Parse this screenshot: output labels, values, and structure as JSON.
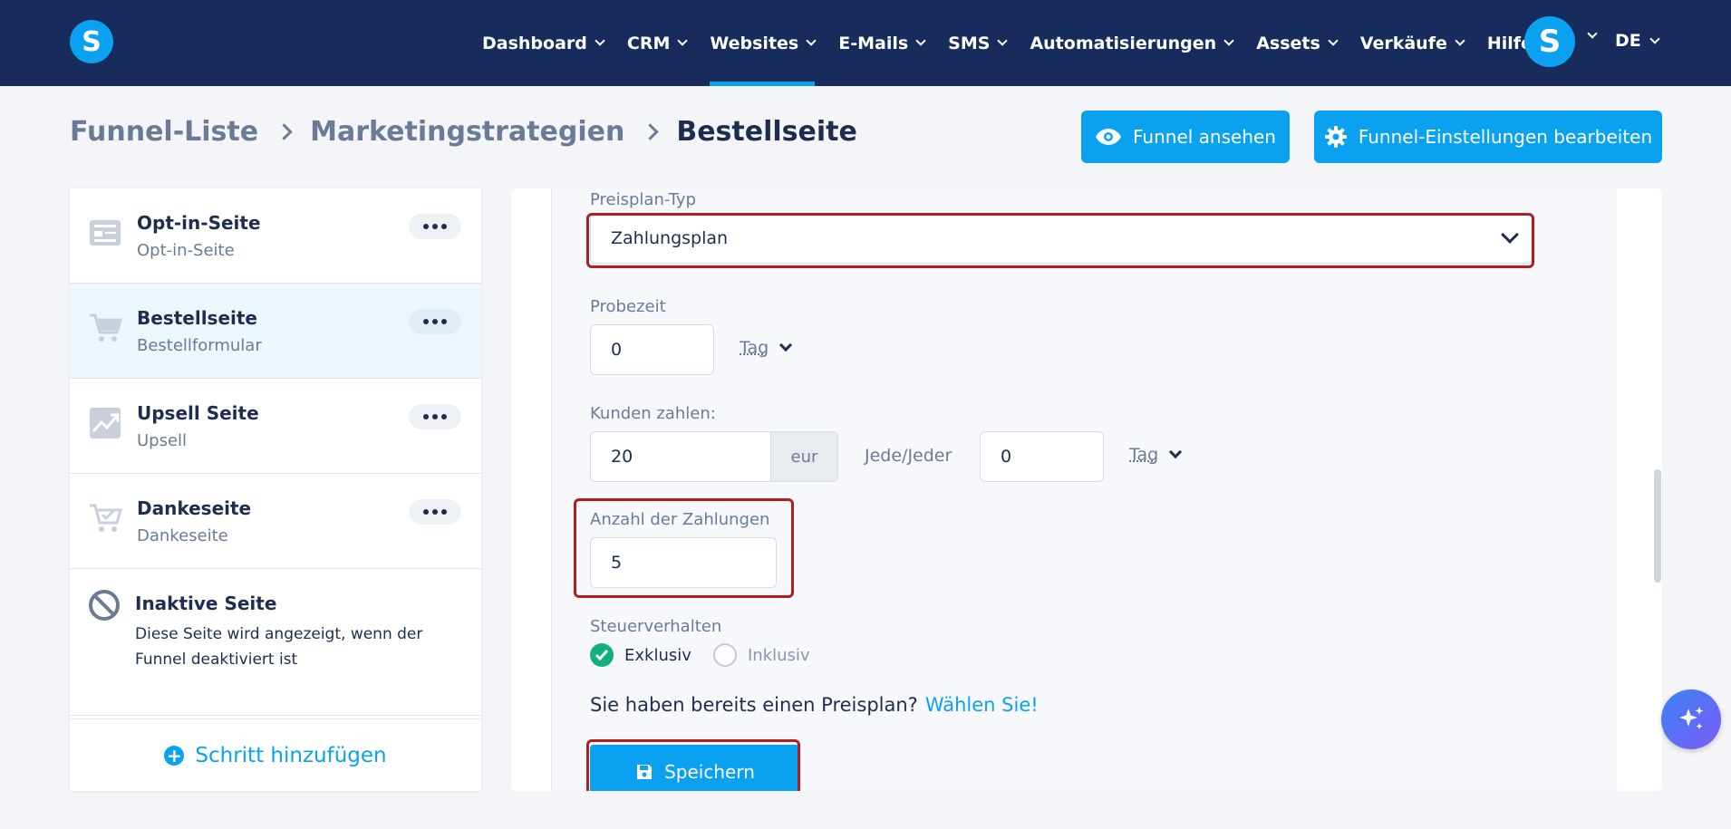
{
  "nav": {
    "logo": "S",
    "items": [
      {
        "label": "Dashboard",
        "dropdown": true
      },
      {
        "label": "CRM",
        "dropdown": true
      },
      {
        "label": "Websites",
        "dropdown": true,
        "active": true
      },
      {
        "label": "E-Mails",
        "dropdown": true
      },
      {
        "label": "SMS",
        "dropdown": true
      },
      {
        "label": "Automatisierungen",
        "dropdown": true
      },
      {
        "label": "Assets",
        "dropdown": true
      },
      {
        "label": "Verkäufe",
        "dropdown": true
      },
      {
        "label": "Hilfe",
        "dropdown": false
      }
    ],
    "avatar_letter": "S",
    "language": "DE"
  },
  "breadcrumb": {
    "items": [
      "Funnel-Liste",
      "Marketingstrategien"
    ],
    "current": "Bestellseite"
  },
  "header_buttons": {
    "view": "Funnel ansehen",
    "settings": "Funnel-Einstellungen bearbeiten"
  },
  "sidebar": {
    "steps": [
      {
        "title": "Opt-in-Seite",
        "subtitle": "Opt-in-Seite",
        "icon": "optin-page-icon"
      },
      {
        "title": "Bestellseite",
        "subtitle": "Bestellformular",
        "icon": "cart-icon",
        "active": true
      },
      {
        "title": "Upsell Seite",
        "subtitle": "Upsell",
        "icon": "trend-chart-icon"
      },
      {
        "title": "Dankeseite",
        "subtitle": "Dankeseite",
        "icon": "cart-check-icon"
      }
    ],
    "inactive": {
      "title": "Inaktive Seite",
      "description": "Diese Seite wird angezeigt, wenn der Funnel deaktiviert ist"
    },
    "add_step": "Schritt hinzufügen"
  },
  "form": {
    "plan_type_label": "Preisplan-Typ",
    "plan_type_value": "Zahlungsplan",
    "trial_label": "Probezeit",
    "trial_value": "0",
    "trial_unit": "Tag",
    "pay_label": "Kunden zahlen:",
    "pay_value": "20",
    "currency": "eur",
    "every_label": "Jede/Jeder",
    "every_value": "0",
    "every_unit": "Tag",
    "payments_label": "Anzahl der Zahlungen",
    "payments_value": "5",
    "tax_label": "Steuerverhalten",
    "tax_options": [
      "Exklusiv",
      "Inklusiv"
    ],
    "tax_selected": "Exklusiv",
    "existing_plan_text": "Sie haben bereits einen Preisplan?",
    "existing_plan_link": "Wählen Sie!",
    "save_label": "Speichern"
  },
  "colors": {
    "nav_bg": "#172b5c",
    "accent": "#0aa2f0",
    "highlight": "#b01e22",
    "radio_on": "#12b07c"
  }
}
